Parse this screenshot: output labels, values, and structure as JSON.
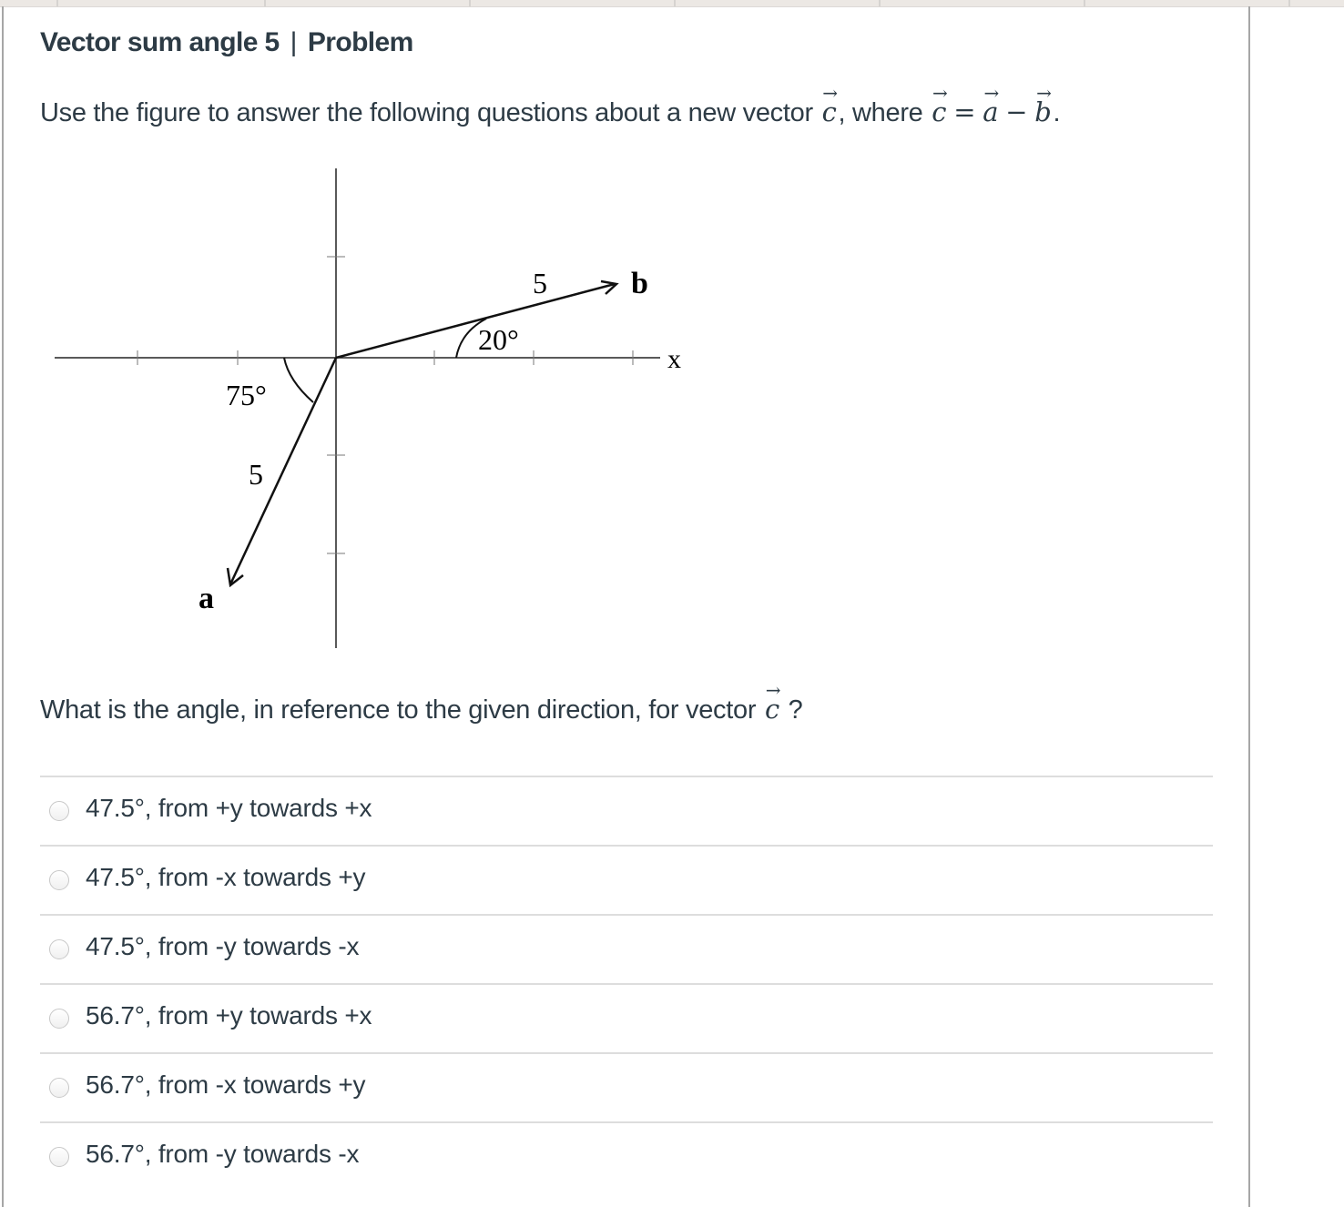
{
  "title": {
    "main": "Vector sum angle 5",
    "separator": "|",
    "section": "Problem"
  },
  "prompt": {
    "text_before": "Use the figure to answer the following questions about a new vector",
    "vector_c": "c",
    "text_middle": ", where",
    "eq_lhs": "c",
    "equals": "=",
    "eq_a": "a",
    "minus": "−",
    "eq_b": "b",
    "period": ".",
    "arrow_glyph": "→"
  },
  "figure": {
    "axis_label_x": "x",
    "vector_a": {
      "label": "a",
      "magnitude_label": "5",
      "angle_label": "75°",
      "magnitude": 5,
      "angle_deg_from_neg_x_toward_neg_y": 75
    },
    "vector_b": {
      "label": "b",
      "magnitude_label": "5",
      "angle_label": "20°",
      "magnitude": 5,
      "angle_deg_from_pos_x_toward_pos_y": 20
    }
  },
  "question": {
    "text": "What is the angle, in reference to the given direction, for vector",
    "vector": "c",
    "suffix": "?"
  },
  "answers": [
    {
      "label": "47.5°, from +y towards +x",
      "selected": false
    },
    {
      "label": "47.5°, from -x towards +y",
      "selected": false
    },
    {
      "label": "47.5°, from -y towards -x",
      "selected": false
    },
    {
      "label": "56.7°, from +y towards +x",
      "selected": false
    },
    {
      "label": "56.7°, from -x towards +y",
      "selected": false
    },
    {
      "label": "56.7°, from -y towards -x",
      "selected": false
    }
  ],
  "colors": {
    "text": "#2d3b45",
    "divider": "#dddddd",
    "rule": "#a6a6a6",
    "top_strip": "#ece8e4"
  }
}
